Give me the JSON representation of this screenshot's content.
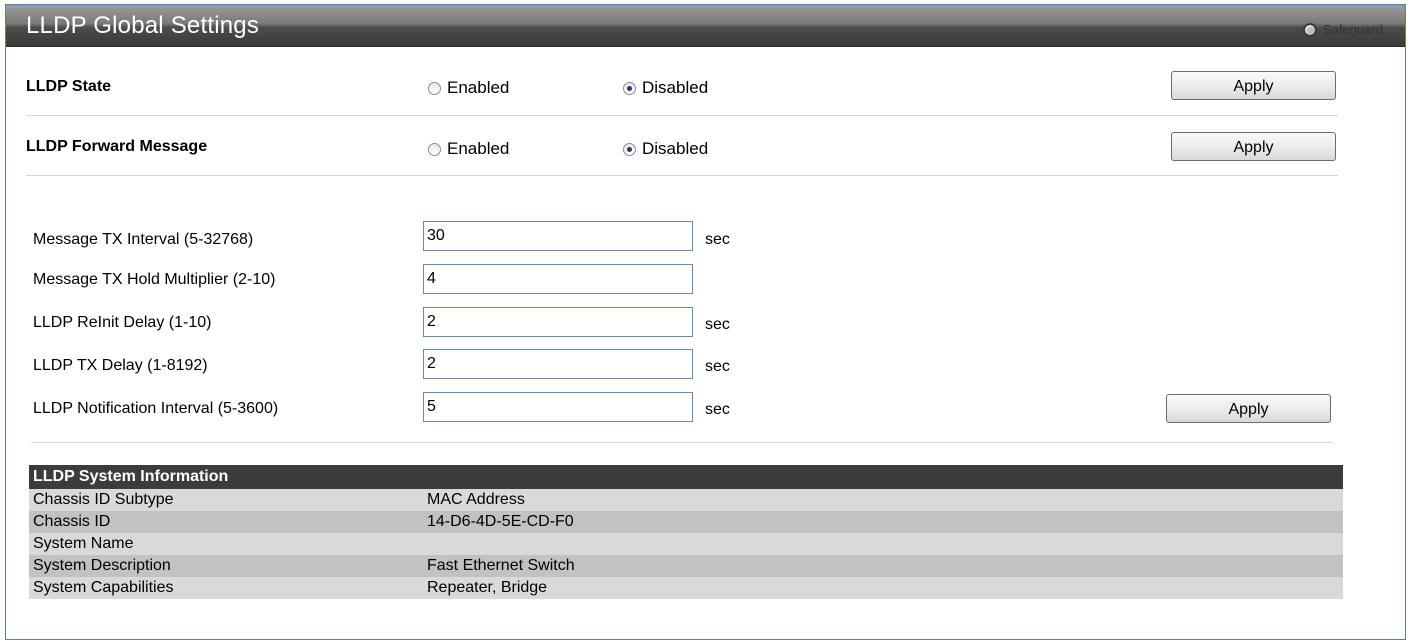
{
  "header": {
    "title": "LLDP Global Settings",
    "safeguard_label": "Safeguard"
  },
  "lldp_state": {
    "label": "LLDP State",
    "options": [
      "Enabled",
      "Disabled"
    ],
    "selected": "Disabled",
    "apply_label": "Apply"
  },
  "lldp_forward": {
    "label": "LLDP Forward Message",
    "options": [
      "Enabled",
      "Disabled"
    ],
    "selected": "Disabled",
    "apply_label": "Apply"
  },
  "timers": {
    "fields": [
      {
        "label": "Message TX Interval (5-32768)",
        "value": "30",
        "unit": "sec"
      },
      {
        "label": "Message TX Hold Multiplier (2-10)",
        "value": "4",
        "unit": ""
      },
      {
        "label": "LLDP ReInit Delay (1-10)",
        "value": "2",
        "unit": "sec"
      },
      {
        "label": "LLDP TX Delay (1-8192)",
        "value": "2",
        "unit": "sec"
      },
      {
        "label": "LLDP Notification Interval (5-3600)",
        "value": "5",
        "unit": "sec"
      }
    ],
    "apply_label": "Apply"
  },
  "system_info": {
    "header": "LLDP System Information",
    "rows": [
      {
        "name": "Chassis ID Subtype",
        "value": "MAC Address"
      },
      {
        "name": "Chassis ID",
        "value": "14-D6-4D-5E-CD-F0"
      },
      {
        "name": "System Name",
        "value": ""
      },
      {
        "name": "System Description",
        "value": "Fast Ethernet Switch"
      },
      {
        "name": "System Capabilities",
        "value": "Repeater, Bridge"
      }
    ]
  },
  "colors": {
    "title_bar": "#3a3a3a",
    "table_header": "#3c3c3c",
    "row_light": "#d9d9d9",
    "row_dark": "#c2c2c2"
  }
}
